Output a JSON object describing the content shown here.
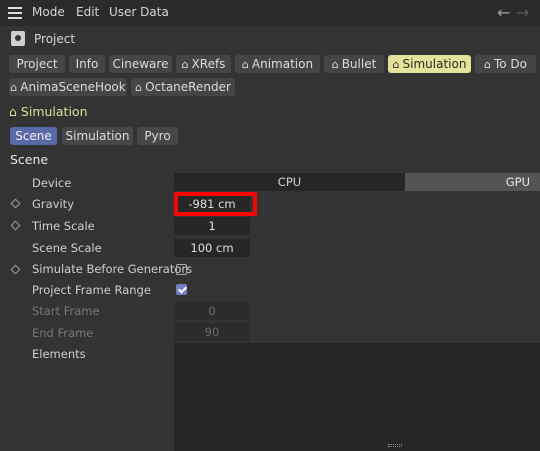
{
  "menubar": {
    "items": [
      "Mode",
      "Edit",
      "User Data"
    ],
    "back_arrow": "←",
    "forward_arrow": "→"
  },
  "project": {
    "title": "Project"
  },
  "tabs": [
    {
      "label": "Project"
    },
    {
      "label": "Info"
    },
    {
      "label": "Cineware"
    },
    {
      "label": "XRefs",
      "icon": "⌂"
    },
    {
      "label": "Animation",
      "icon": "⌂"
    },
    {
      "label": "Bullet",
      "icon": "⌂"
    },
    {
      "label": "Simulation",
      "icon": "⌂",
      "active": true
    },
    {
      "label": "To Do",
      "icon": "⌂"
    },
    {
      "label": "AnimaSceneHook",
      "icon": "⌂"
    },
    {
      "label": "OctaneRender",
      "icon": "⌂"
    }
  ],
  "section": {
    "icon": "⌂",
    "title": "Simulation"
  },
  "subtabs": [
    "Scene",
    "Simulation",
    "Pyro"
  ],
  "group_title": "Scene",
  "attributes": {
    "device": {
      "label": "Device",
      "options": [
        "CPU",
        "GPU"
      ],
      "selected": "GPU"
    },
    "gravity": {
      "label": "Gravity",
      "value": "-981 cm"
    },
    "time_scale": {
      "label": "Time Scale",
      "value": "1"
    },
    "scene_scale": {
      "label": "Scene Scale",
      "value": "100 cm"
    },
    "simulate_before_generators": {
      "label": "Simulate Before Generators",
      "checked": false
    },
    "project_frame_range": {
      "label": "Project Frame Range",
      "checked": true
    },
    "start_frame": {
      "label": "Start Frame",
      "value": "0"
    },
    "end_frame": {
      "label": "End Frame",
      "value": "90"
    },
    "elements": {
      "label": "Elements"
    }
  },
  "colors": {
    "active_tab": "#e3e49a",
    "active_subtab": "#5a6aa8",
    "highlight": "#ff0000"
  }
}
